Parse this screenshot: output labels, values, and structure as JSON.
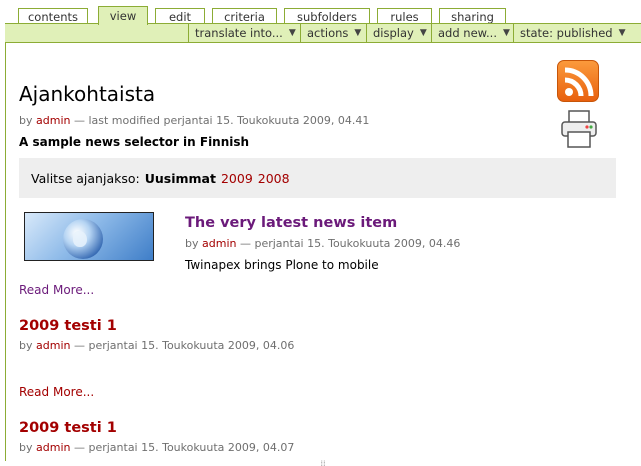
{
  "tabs": [
    "contents",
    "view",
    "edit",
    "criteria",
    "subfolders",
    "rules",
    "sharing"
  ],
  "actions": [
    {
      "label": "translate into..."
    },
    {
      "label": "actions"
    },
    {
      "label": "display"
    },
    {
      "label": "add new..."
    },
    {
      "label": "state: published"
    }
  ],
  "page": {
    "title": "Ajankohtaista",
    "byline_prefix": "by",
    "author": "admin",
    "byline_suffix": "— last modified perjantai 15. Toukokuuta 2009, 04.41",
    "description": "A sample news selector in Finnish"
  },
  "selector": {
    "label": "Valitse ajanjakso:",
    "current": "Uusimmat",
    "years": [
      "2009",
      "2008"
    ]
  },
  "items": [
    {
      "title": "The very latest news item",
      "author": "admin",
      "date": "— perjantai 15. Toukokuuta 2009, 04.46",
      "text": "Twinapex brings Plone to mobile",
      "read_more": "Read More..."
    },
    {
      "title": "2009 testi 1",
      "author": "admin",
      "date": "— perjantai 15. Toukokuuta 2009, 04.06",
      "read_more": "Read More..."
    },
    {
      "title": "2009 testi 1",
      "author": "admin",
      "date": "— perjantai 15. Toukokuuta 2009, 04.07"
    }
  ],
  "icons": {
    "rss": "rss-feed-icon",
    "print": "printer-icon"
  },
  "colors": {
    "accent": "#8cac35",
    "tab_active": "#e0f0b8",
    "link_red": "#a30000",
    "link_purple": "#6b1a7a"
  }
}
